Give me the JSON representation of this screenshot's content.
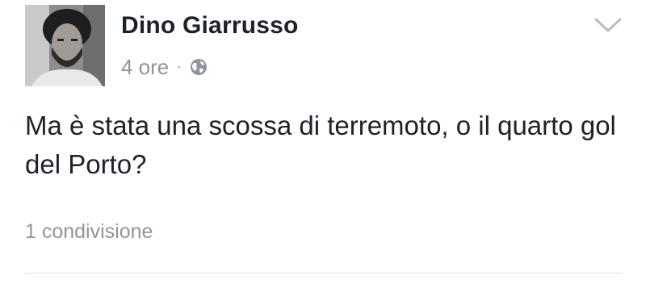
{
  "post": {
    "author": "Dino Giarrusso",
    "time": "4 ore",
    "separator": "·",
    "privacy_icon": "globe-icon",
    "menu_icon": "chevron-down-icon",
    "avatar_icon": "profile-photo",
    "text": "Ma è stata una scossa di terremoto, o il quarto gol del Porto?",
    "shares": "1 condivisione"
  },
  "colors": {
    "name": "#1d2129",
    "meta": "#90949c",
    "divider": "#dddfe2"
  }
}
